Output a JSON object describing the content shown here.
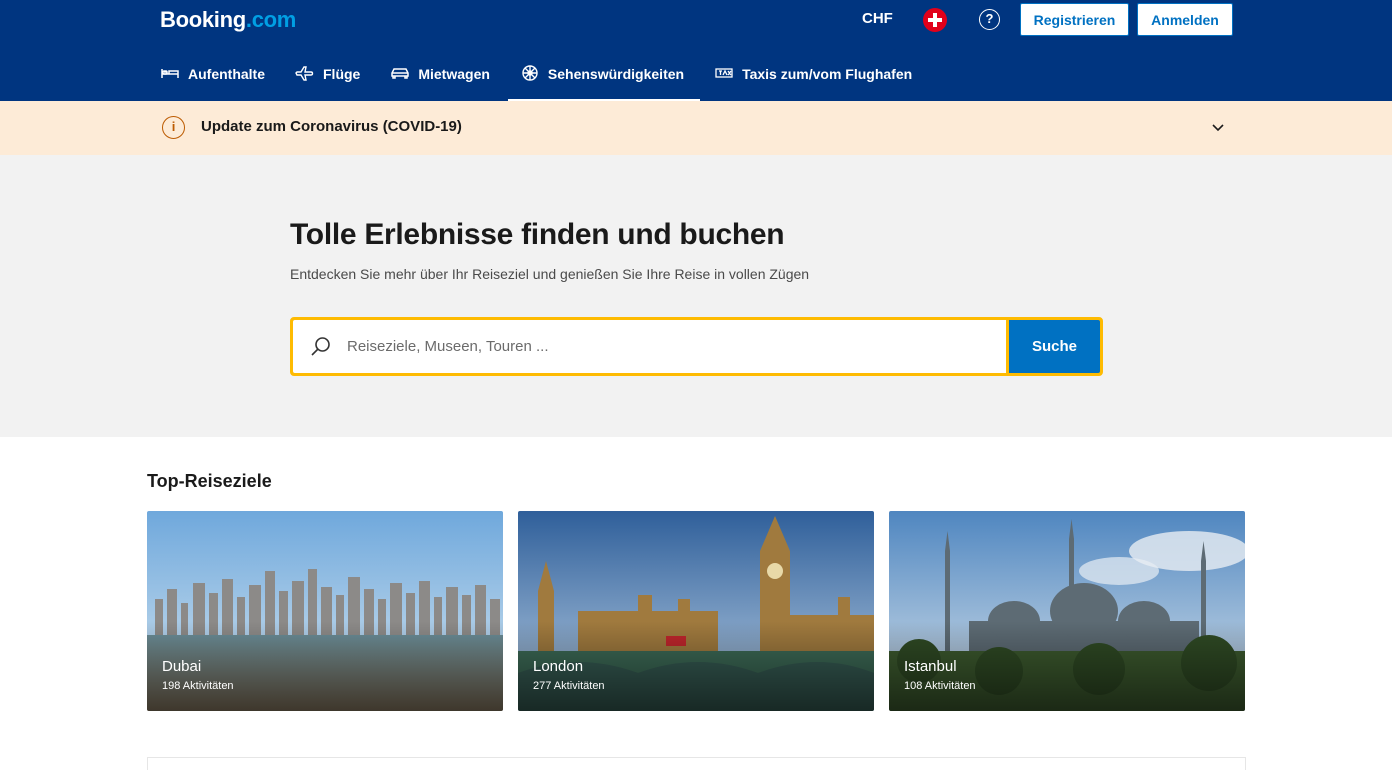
{
  "header": {
    "logo_main": "Booking",
    "logo_dot": ".com",
    "currency": "CHF",
    "help_symbol": "?",
    "register_label": "Registrieren",
    "login_label": "Anmelden",
    "bg_color": "#003580"
  },
  "nav": {
    "items": [
      {
        "label": "Aufenthalte",
        "icon": "bed-icon"
      },
      {
        "label": "Flüge",
        "icon": "plane-icon"
      },
      {
        "label": "Mietwagen",
        "icon": "car-icon"
      },
      {
        "label": "Sehenswürdigkeiten",
        "icon": "attractions-icon",
        "active": true
      },
      {
        "label": "Taxis zum/vom Flughafen",
        "icon": "taxi-icon"
      }
    ]
  },
  "covid": {
    "text": "Update zum Coronavirus (COVID-19)",
    "icon_symbol": "i"
  },
  "hero": {
    "title": "Tolle Erlebnisse finden und buchen",
    "subtitle": "Entdecken Sie mehr über Ihr Reiseziel und genießen Sie Ihre Reise in vollen Zügen",
    "search_placeholder": "Reiseziele, Museen, Touren ...",
    "search_button": "Suche"
  },
  "destinations": {
    "title": "Top-Reiseziele",
    "items": [
      {
        "name": "Dubai",
        "count": "198 Aktivitäten"
      },
      {
        "name": "London",
        "count": "277 Aktivitäten"
      },
      {
        "name": "Istanbul",
        "count": "108 Aktivitäten"
      }
    ]
  }
}
